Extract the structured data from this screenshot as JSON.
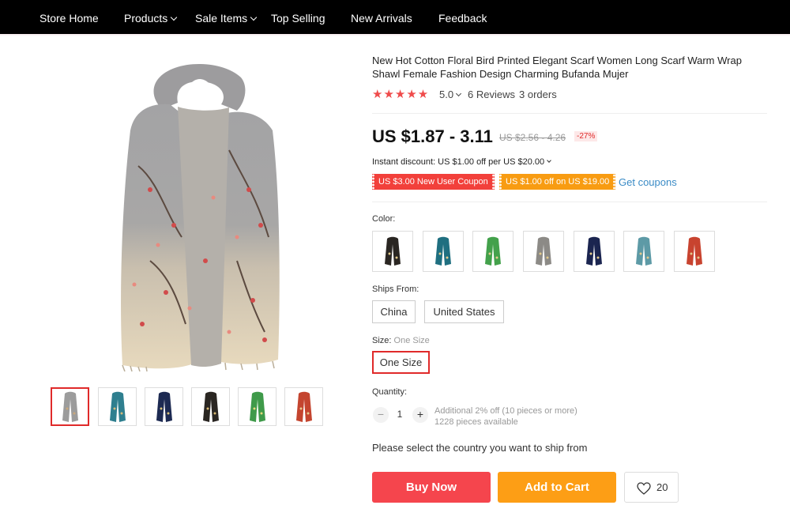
{
  "nav": {
    "items": [
      {
        "label": "Store Home",
        "dropdown": false
      },
      {
        "label": "Products",
        "dropdown": true
      },
      {
        "label": "Sale Items",
        "dropdown": true
      },
      {
        "label": "Top Selling",
        "dropdown": false
      },
      {
        "label": "New Arrivals",
        "dropdown": false
      },
      {
        "label": "Feedback",
        "dropdown": false
      }
    ]
  },
  "gallery": {
    "thumbnails": [
      {
        "color": "#9c9c9c",
        "active": true
      },
      {
        "color": "#2f7f8f",
        "active": false
      },
      {
        "color": "#1d2a52",
        "active": false
      },
      {
        "color": "#2a2622",
        "active": false
      },
      {
        "color": "#3f9a4a",
        "active": false
      },
      {
        "color": "#c4452f",
        "active": false
      }
    ]
  },
  "product": {
    "title": "New Hot Cotton Floral Bird Printed Elegant Scarf Women Long Scarf Warm Wrap Shawl Female Fashion Design Charming Bufanda Mujer",
    "rating": "5.0",
    "reviews": "6 Reviews",
    "orders": "3 orders",
    "stars": "★★★★★",
    "price": "US $1.87 - 3.11",
    "old_price": "US $2.56 - 4.26",
    "discount": "-27%",
    "instant_discount": "Instant discount: US $1.00 off per US $20.00",
    "coupon_new_user": "US $3.00 New User Coupon",
    "coupon_off": "US $1.00 off on US $19.00",
    "get_coupons": "Get coupons"
  },
  "options": {
    "color_label": "Color:",
    "colors": [
      "#2a2622",
      "#1f6f80",
      "#43a14b",
      "#8c8a86",
      "#1b2550",
      "#5d9aa6",
      "#c8432f"
    ],
    "ships_from_label": "Ships From:",
    "ships_from": [
      "China",
      "United States"
    ],
    "size_label": "Size:",
    "size_value": "One Size",
    "sizes": [
      "One Size"
    ],
    "quantity_label": "Quantity:",
    "quantity": "1",
    "minus": "−",
    "plus": "+",
    "bulk_note": "Additional 2% off (10 pieces or more)",
    "available": "1228 pieces available"
  },
  "actions": {
    "ship_message": "Please select the country you want to ship from",
    "buy_now": "Buy Now",
    "add_to_cart": "Add to Cart",
    "wishlist_count": "20"
  },
  "colors": {
    "nav_bg": "#000000",
    "accent_red": "#f5454d",
    "accent_orange": "#fd9e15",
    "link_blue": "#3a8bc6",
    "star_red": "#ef4b4b"
  }
}
